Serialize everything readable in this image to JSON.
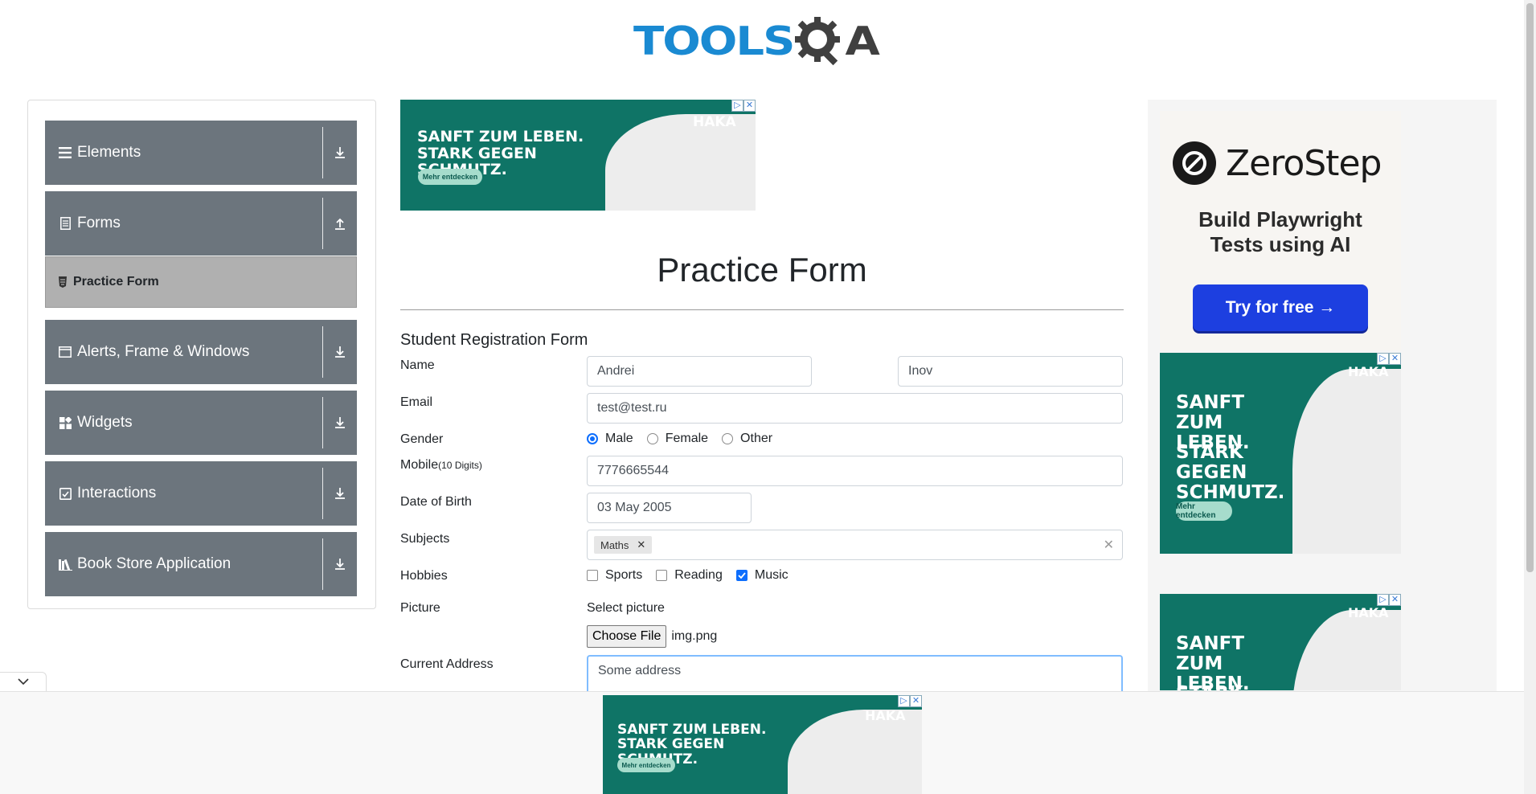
{
  "logo": {
    "text_tools": "TOOLS",
    "text_a": "A"
  },
  "sidebar": {
    "groups": [
      {
        "label": "Elements",
        "icon": "hamburger-icon",
        "state": "collapsed"
      },
      {
        "label": "Forms",
        "icon": "document-icon",
        "state": "expanded"
      },
      {
        "label": "Alerts, Frame & Windows",
        "icon": "window-icon",
        "state": "collapsed"
      },
      {
        "label": "Widgets",
        "icon": "widgets-icon",
        "state": "collapsed"
      },
      {
        "label": "Interactions",
        "icon": "interactions-icon",
        "state": "collapsed"
      },
      {
        "label": "Book Store Application",
        "icon": "books-icon",
        "state": "collapsed"
      }
    ],
    "active_item": {
      "label": "Practice Form",
      "icon": "html-file-icon"
    }
  },
  "ads": {
    "haka": {
      "headline": "SANFT ZUM LEBEN. STARK GEGEN SCHMUTZ.",
      "headline_tall_1": "SANFT ZUM LEBEN.",
      "headline_tall_2": "STARK GEGEN SCHMUTZ.",
      "brand": "HAKA",
      "cta": "Mehr entdecken",
      "colors": {
        "background": "#0f7466",
        "cta": "#a6dccc"
      }
    },
    "zerostep": {
      "name": "ZeroStep",
      "tagline_1": "Build Playwright",
      "tagline_2": "Tests using AI",
      "cta": "Try for free →",
      "colors": {
        "button": "#1d3fe0"
      }
    }
  },
  "form": {
    "page_title": "Practice Form",
    "form_title": "Student Registration Form",
    "labels": {
      "name": "Name",
      "email": "Email",
      "gender": "Gender",
      "mobile": "Mobile",
      "mobile_hint": "(10 Digits)",
      "dob": "Date of Birth",
      "subjects": "Subjects",
      "hobbies": "Hobbies",
      "picture": "Picture",
      "address": "Current Address"
    },
    "values": {
      "first_name": "Andrei",
      "last_name": "Inov",
      "email": "test@test.ru",
      "mobile": "7776665544",
      "dob": "03 May 2005",
      "address": "Some address"
    },
    "gender_options": [
      {
        "label": "Male",
        "selected": true
      },
      {
        "label": "Female",
        "selected": false
      },
      {
        "label": "Other",
        "selected": false
      }
    ],
    "subjects": [
      "Maths"
    ],
    "hobbies": [
      {
        "label": "Sports",
        "checked": false
      },
      {
        "label": "Reading",
        "checked": false
      },
      {
        "label": "Music",
        "checked": true
      }
    ],
    "picture": {
      "select_label": "Select picture",
      "button": "Choose File",
      "file": "img.png"
    },
    "accent_color": "#0d6efd"
  }
}
